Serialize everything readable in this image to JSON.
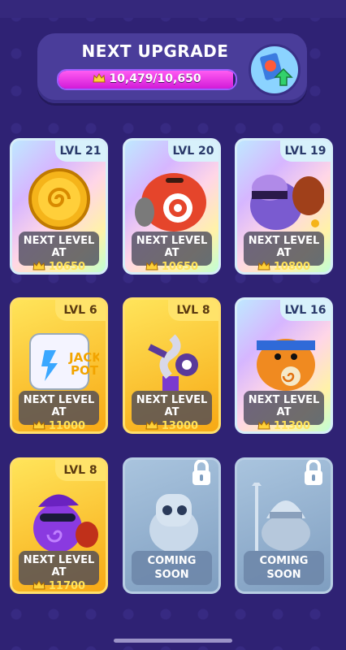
{
  "header": {
    "title": "NEXT UPGRADE",
    "progress_text": "10,479/10,650",
    "progress_fraction": 0.984
  },
  "cards": [
    {
      "level": "LVL 21",
      "label": "NEXT LEVEL AT",
      "value": "10650",
      "style": "rainbow",
      "art": "gold-coin"
    },
    {
      "level": "LVL 20",
      "label": "NEXT LEVEL AT",
      "value": "10650",
      "style": "rainbow",
      "art": "red-target-monster"
    },
    {
      "level": "LVL 19",
      "label": "NEXT LEVEL AT",
      "value": "10800",
      "style": "rainbow",
      "art": "purple-thief-hippo"
    },
    {
      "level": "LVL 6",
      "label": "NEXT LEVEL AT",
      "value": "11000",
      "style": "gold",
      "art": "jackpot-dice"
    },
    {
      "level": "LVL 8",
      "label": "NEXT LEVEL AT",
      "value": "13000",
      "style": "gold",
      "art": "jack-in-box"
    },
    {
      "level": "LVL 16",
      "label": "NEXT LEVEL AT",
      "value": "11300",
      "style": "rainbow",
      "art": "orange-ninja-monster"
    },
    {
      "level": "LVL 8",
      "label": "NEXT LEVEL AT",
      "value": "11700",
      "style": "gold",
      "art": "purple-jester-monster"
    },
    {
      "level": "",
      "label": "COMING",
      "value": "SOON",
      "style": "locked",
      "art": "locked-bear"
    },
    {
      "level": "",
      "label": "COMING",
      "value": "SOON",
      "style": "locked",
      "art": "locked-knight"
    }
  ],
  "colors": {
    "background": "#2f2274",
    "accent": "#d21ad8",
    "gold": "#ffe25a"
  }
}
